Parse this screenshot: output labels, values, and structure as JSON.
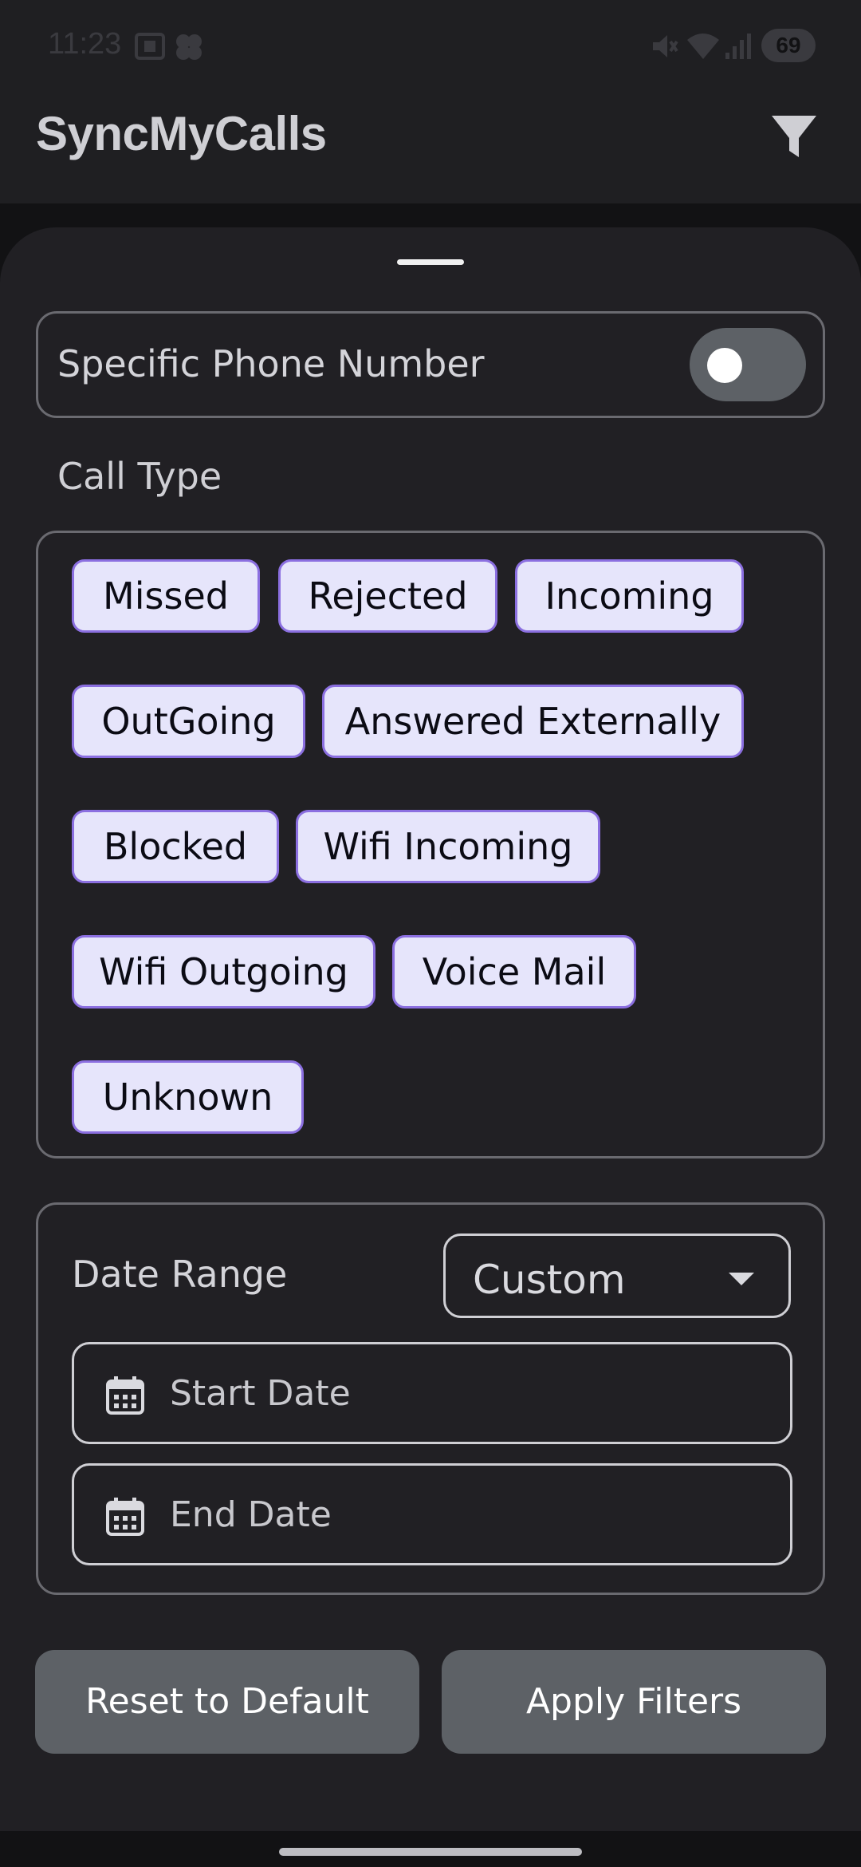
{
  "status_bar": {
    "time": "11:23",
    "battery": "69",
    "icons": [
      "screenshot-icon",
      "pinwheel-icon",
      "mute-icon",
      "wifi-icon",
      "signal-icon",
      "battery-icon"
    ]
  },
  "app_bar": {
    "title": "SyncMyCalls",
    "filter_icon": "filter-icon"
  },
  "sheet": {
    "phone_filter": {
      "label": "Specific Phone Number",
      "enabled": false
    },
    "call_type": {
      "label": "Call Type",
      "chips": [
        "Missed",
        "Rejected",
        "Incoming",
        "OutGoing",
        "Answered Externally",
        "Blocked",
        "Wifi Incoming",
        "Wifi Outgoing",
        "Voice Mail",
        "Unknown"
      ]
    },
    "date_range": {
      "label": "Date Range",
      "selected": "Custom",
      "start_placeholder": "Start Date",
      "end_placeholder": "End Date"
    },
    "buttons": {
      "reset": "Reset to Default",
      "apply": "Apply Filters"
    }
  },
  "colors": {
    "background": "#121214",
    "sheet": "#212024",
    "chip_fill": "#e6e5fb",
    "chip_border": "#8b6fe0",
    "button": "#5d6166",
    "outline": "#6a6a70"
  }
}
